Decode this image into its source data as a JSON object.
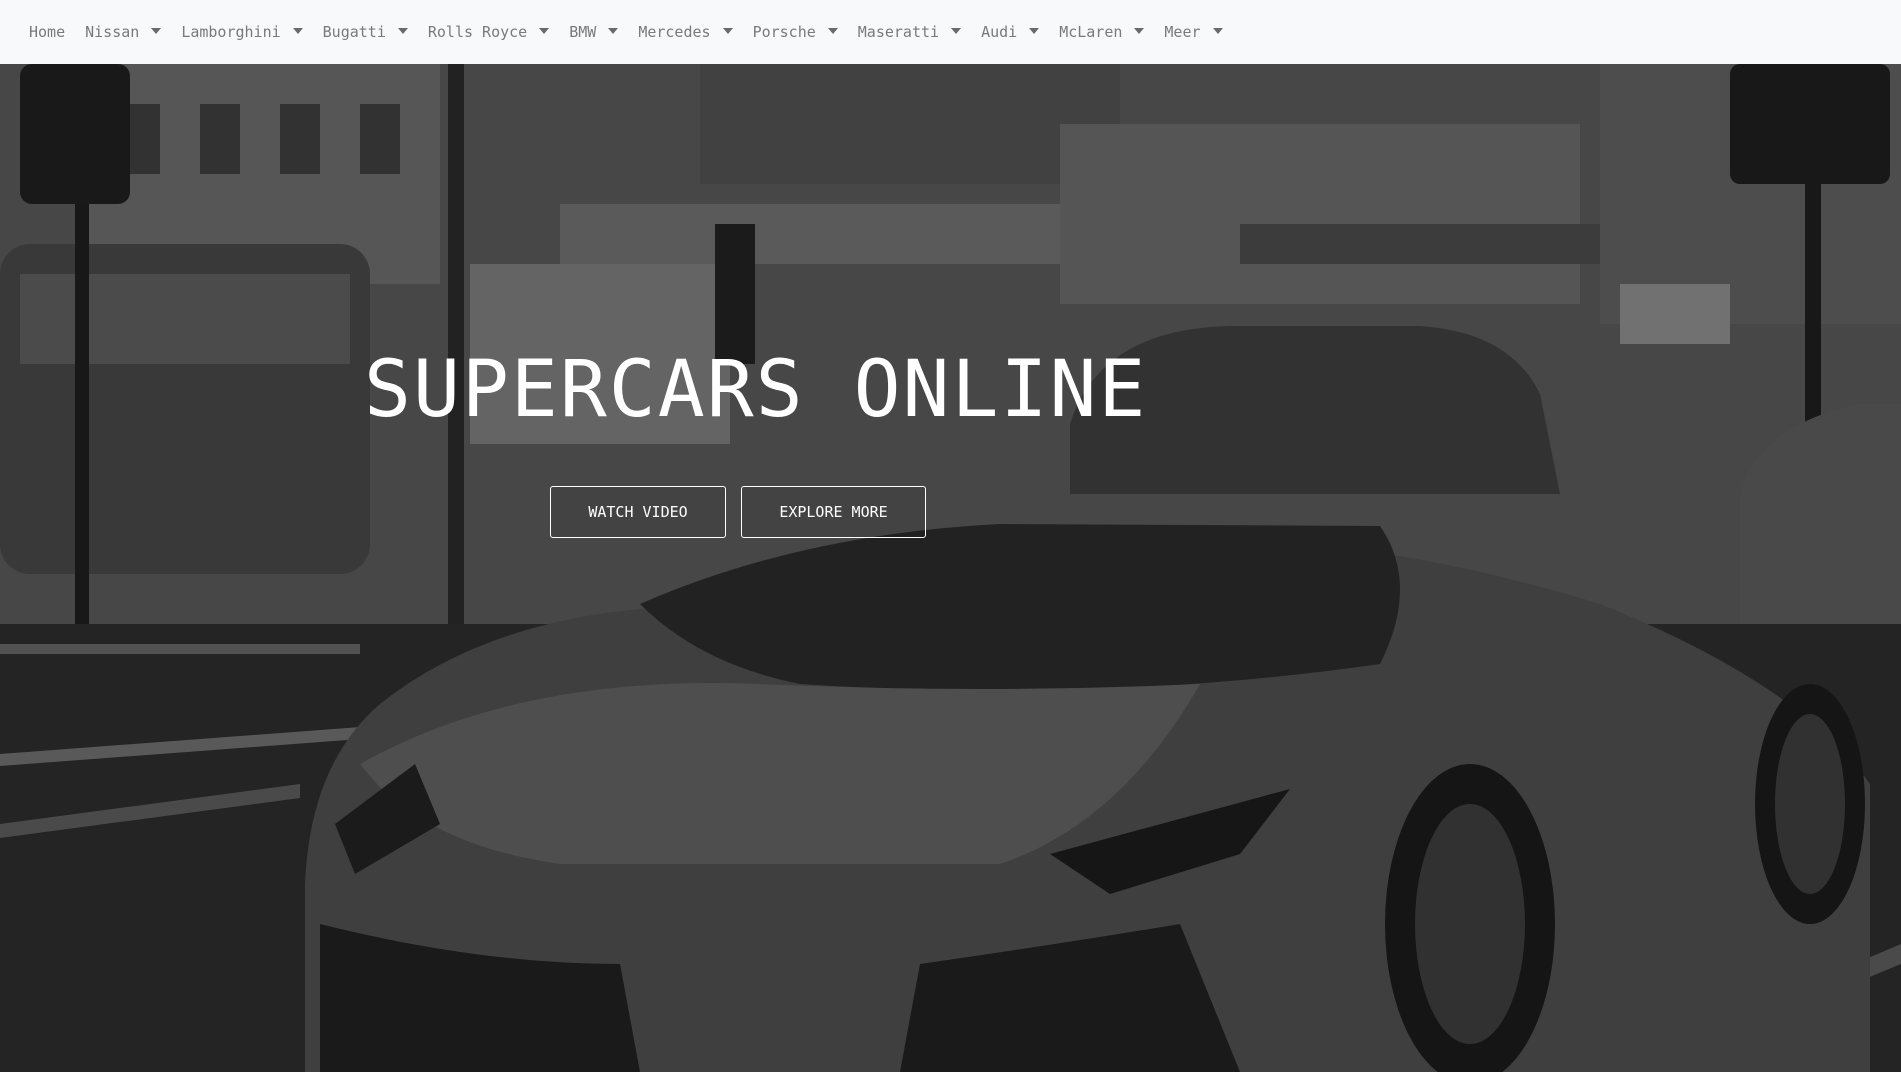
{
  "nav": {
    "items": [
      {
        "label": "Home",
        "dropdown": false
      },
      {
        "label": "Nissan",
        "dropdown": true
      },
      {
        "label": "Lamborghini",
        "dropdown": true
      },
      {
        "label": "Bugatti",
        "dropdown": true
      },
      {
        "label": "Rolls Royce",
        "dropdown": true
      },
      {
        "label": "BMW",
        "dropdown": true
      },
      {
        "label": "Mercedes",
        "dropdown": true
      },
      {
        "label": "Porsche",
        "dropdown": true
      },
      {
        "label": "Maseratti",
        "dropdown": true
      },
      {
        "label": "Audi",
        "dropdown": true
      },
      {
        "label": "McLaren",
        "dropdown": true
      },
      {
        "label": "Meer",
        "dropdown": true
      }
    ]
  },
  "hero": {
    "title": "SUPERCARS ONLINE",
    "watch_label": "WATCH VIDEO",
    "explore_label": "EXPLORE MORE",
    "background": "black-and-white photo of a supercar on a city street"
  },
  "colors": {
    "navbar_bg": "#f8f9fa",
    "nav_text": "#7a7a7a",
    "hero_text": "#ffffff"
  }
}
